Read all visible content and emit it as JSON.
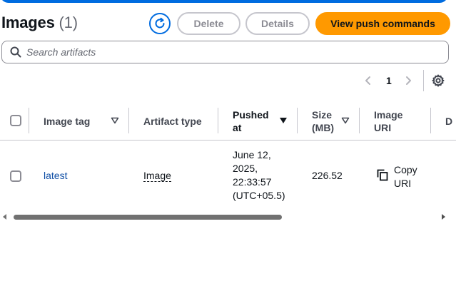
{
  "header": {
    "title": "Images",
    "count": "(1)",
    "delete_label": "Delete",
    "details_label": "Details",
    "push_label": "View push commands"
  },
  "search": {
    "placeholder": "Search artifacts",
    "value": ""
  },
  "pagination": {
    "current_page": "1"
  },
  "table": {
    "columns": [
      {
        "label": "Image tag"
      },
      {
        "label": "Artifact type"
      },
      {
        "label_line1": "Pushed",
        "label_line2": "at"
      },
      {
        "label_line1": "Size",
        "label_line2": "(MB)"
      },
      {
        "label_line1": "Image",
        "label_line2": "URI"
      },
      {
        "label": "D"
      }
    ],
    "rows": [
      {
        "tag": "latest",
        "artifact_type": "Image",
        "pushed_at": [
          "June 12,",
          "2025,",
          "22:33:57",
          "(UTC+05.5)"
        ],
        "size": "226.52",
        "copy_uri": [
          "Copy",
          "URI"
        ]
      }
    ]
  },
  "colors": {
    "accent": "#006ce0",
    "primary_button": "#ff9900",
    "border": "#c6c6cd"
  },
  "icons": [
    "refresh-icon",
    "search-icon",
    "chevron-left-icon",
    "chevron-right-icon",
    "gear-icon",
    "sort-icon",
    "copy-icon"
  ]
}
